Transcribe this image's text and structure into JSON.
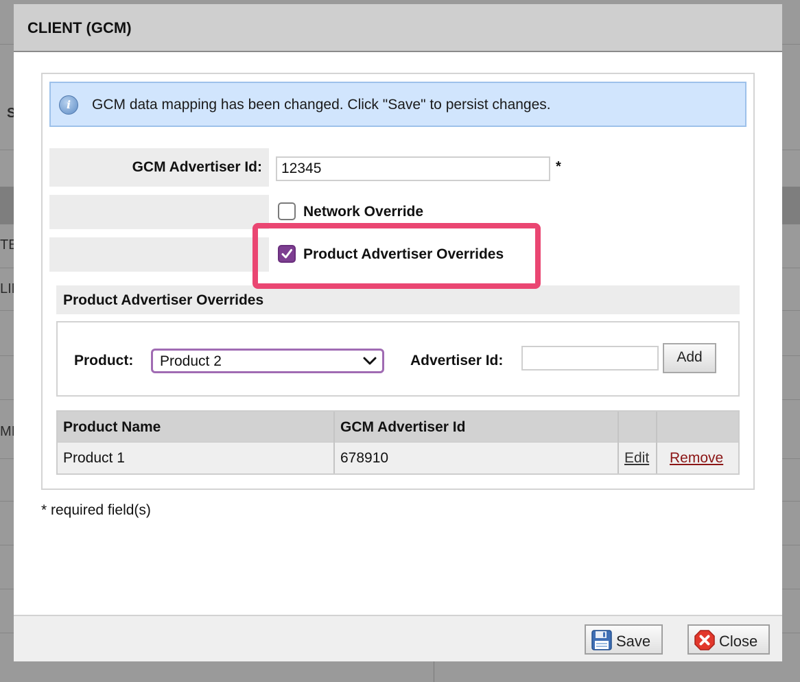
{
  "background": {
    "fragments": [
      "S",
      "TE",
      "LIM",
      "MIT"
    ]
  },
  "dialog": {
    "title": "CLIENT (GCM)",
    "notice": "GCM data mapping has been changed. Click \"Save\" to persist changes.",
    "advertiser_id_label": "GCM Advertiser Id:",
    "advertiser_id_value": "12345",
    "required_marker": "*",
    "network_override": {
      "label": "Network Override",
      "checked": false
    },
    "product_overrides": {
      "label": "Product Advertiser Overrides",
      "checked": true
    },
    "section_title": "Product Advertiser Overrides",
    "product_label": "Product:",
    "product_selected": "Product 2",
    "advertiser_label": "Advertiser Id:",
    "advertiser_value": "",
    "add_label": "Add",
    "table": {
      "headers": [
        "Product Name",
        "GCM Advertiser Id",
        "",
        ""
      ],
      "rows": [
        {
          "name": "Product 1",
          "id": "678910",
          "edit": "Edit",
          "remove": "Remove"
        }
      ]
    },
    "required_note": "* required field(s)",
    "footer": {
      "save_label": "Save",
      "close_label": "Close"
    }
  },
  "colors": {
    "highlight": "#ea4672",
    "checkbox_checked": "#7d3e91",
    "notice_bg": "#d1e5fd"
  }
}
